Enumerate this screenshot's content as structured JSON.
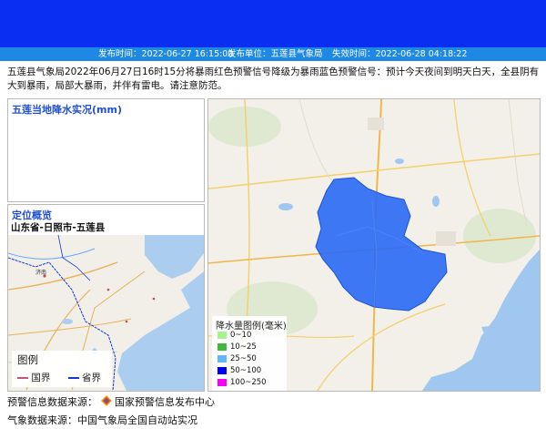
{
  "info_bar": {
    "publish_time": "发布时间：2022-06-27 16:15:00",
    "publisher": "发布单位：五莲县气象局",
    "expire_time": "失效时间：2022-06-28 04:18:22"
  },
  "alert_text": "五莲县气象局2022年06月27日16时15分将暴雨红色预警信号降级为暴雨蓝色预警信号：预计今天夜间到明天白天，全县阴有大到暴雨，局部大暴雨，并伴有雷电。请注意防范。",
  "precip_panel": {
    "title": "五莲当地降水实况(mm)"
  },
  "location_panel": {
    "title": "定位概览",
    "region": "山东省-日照市-五莲县",
    "map_city_label": "济南"
  },
  "mini_legend": {
    "title": "图例",
    "items": [
      {
        "label": "国界",
        "color": "#c2567a"
      },
      {
        "label": "省界",
        "color": "#1438d8"
      }
    ]
  },
  "rain_legend": {
    "title": "降水量图例(毫米)",
    "items": [
      {
        "label": "0~10",
        "color": "#a6f28f"
      },
      {
        "label": "10~25",
        "color": "#3dba3d"
      },
      {
        "label": "25~50",
        "color": "#61b8ff"
      },
      {
        "label": "50~100",
        "color": "#0000ff"
      },
      {
        "label": "100~250",
        "color": "#fa00fa"
      }
    ]
  },
  "footer": {
    "source_label": "预警信息数据来源：",
    "source_org": "国家预警信息发布中心",
    "weather_source": "气象数据来源：中国气象局全国自动站实况"
  }
}
